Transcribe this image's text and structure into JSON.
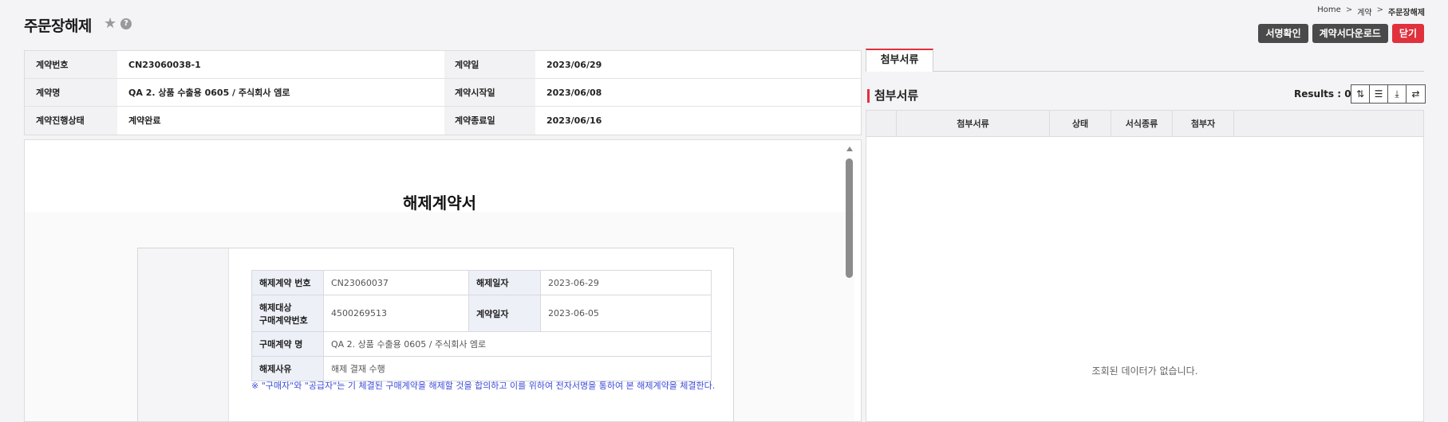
{
  "page": {
    "title": "주문장해제"
  },
  "breadcrumb": {
    "home": "Home",
    "sep": ">",
    "level1": "계약",
    "current": "주문장해제"
  },
  "buttons": {
    "sign_confirm": "서명확인",
    "download": "계약서다운로드",
    "close": "닫기"
  },
  "info": {
    "contract_no_label": "계약번호",
    "contract_no": "CN23060038-1",
    "contract_date_label": "계약일",
    "contract_date": "2023/06/29",
    "contract_name_label": "계약명",
    "contract_name": "QA 2. 상품 수출용 0605 / 주식회사 엠로",
    "start_date_label": "계약시작일",
    "start_date": "2023/06/08",
    "status_label": "계약진행상태",
    "status": "계약완료",
    "end_date_label": "계약종료일",
    "end_date": "2023/06/16"
  },
  "document": {
    "title": "해제계약서",
    "rows": {
      "cancel_no_label": "해제계약 번호",
      "cancel_no": "CN23060037",
      "cancel_date_label": "해제일자",
      "cancel_date": "2023-06-29",
      "target_label_1": "해제대상",
      "target_label_2": "구매계약번호",
      "target_no": "4500269513",
      "contract_date_label": "계약일자",
      "contract_date": "2023-06-05",
      "purchase_name_label": "구매계약 명",
      "purchase_name": "QA 2. 상품 수출용 0605 / 주식회사 엠로",
      "reason_label": "해제사유",
      "reason": "해제 결재 수행"
    },
    "note": "※ \"구매자\"와 \"공급자\"는 기 체결된 구매계약을 해제할 것을 합의하고 이를 위하여 전자서명을 통하여 본 해제계약을 체결한다."
  },
  "attachments": {
    "tab_label": "첨부서류",
    "section_title": "첨부서류",
    "results_label": "Results : 0",
    "columns": [
      "",
      "첨부서류",
      "상태",
      "서식종류",
      "첨부자",
      ""
    ],
    "empty_message": "조회된 데이터가 없습니다."
  },
  "icons": {
    "star": "star-icon",
    "help": "help-icon"
  },
  "colors": {
    "accent_red": "#e0313c",
    "button_dark": "#4a4a4a",
    "note_blue": "#3b4bd8"
  }
}
